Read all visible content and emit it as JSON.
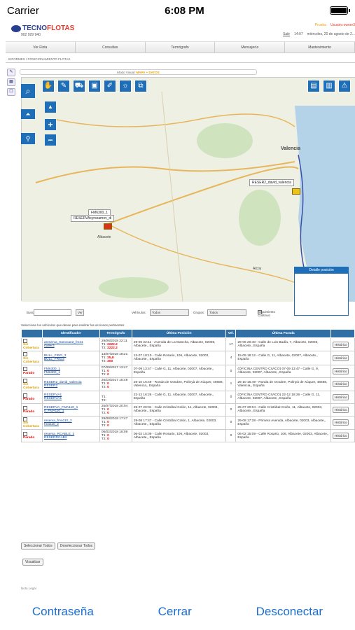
{
  "statusbar": {
    "carrier": "Carrier",
    "time": "6:08 PM"
  },
  "header": {
    "logo_a": "TECNO",
    "logo_b": "FLOTAS",
    "phone": "902 929 940",
    "prueba": "Prueba",
    "usuario": "Usuario:owner3",
    "salir": "Salir",
    "clock": "14:07",
    "date": "miércoles, 20 de agosto de 2..."
  },
  "nav": [
    "Ver Flota",
    "Consultas",
    "Termógrafo",
    "Mensajería",
    "Mantenimiento"
  ],
  "breadcrumb": "INFORMES / POSICIONAMIENTO FLOTAS",
  "modo": {
    "label": "Modo Visual:",
    "value": "MAPA + DATOS"
  },
  "map": {
    "cities": [
      "Valencia",
      "Albacete",
      "Alcoy"
    ],
    "popups": [
      "RESER2_david_valencia",
      "FM6300_1",
      "RESERVAcyrseamov_di"
    ],
    "detail_title": "Detalle posición"
  },
  "controls": {
    "buscar": "Buscar",
    "ver": "Ver",
    "vehiculos": "Vehículos:",
    "vehiculos_val": "Todos",
    "grupos": "Grupos:",
    "grupos_val": "Todos",
    "seguimiento": "Seguimiento Continuo"
  },
  "note": "Seleccione los vehículos que desee para realizar las acciones pertinentes",
  "table": {
    "headers": [
      "Identificador",
      "Termógrafo",
      "Última Posición",
      "Vel.",
      "Última Parada",
      ""
    ],
    "rows": [
      {
        "status": "Sin Cobertura",
        "st": "yel",
        "id1": "areserva_tranvcan2_fm41",
        "id2": "rtaller3",
        "termo": "29/06/2018 22:11",
        "t1": "2222.2",
        "t2": "2222.2",
        "pos": "29-06 22:11 - Avenida de La Mancha, Albacete, 02006, Albacete,, España",
        "vel": "17",
        "parada": "29-06 20:40 - Calle de Luis Badía, 7, Albacete, 02003, Albacete,, España",
        "btn": "Histórico"
      },
      {
        "status": "Sin Cobertura",
        "st": "yel",
        "id1": "BULL_FRIO_3",
        "id2": "BULL_FRIO3",
        "termo": "13/07/2018 18:21",
        "t1": "25,8",
        "t2": "300",
        "pos": "13-07 18:10 - Calle Rosario, 106, Albacete, 02003, Albacete,, España",
        "vel": "4",
        "parada": "15-09 18:12 - Calle G, 11, Albacete, 02007, Albacete,, España",
        "btn": "Histórico"
      },
      {
        "status": "Parado",
        "st": "red",
        "id1": "FM6300_1",
        "id2": "FM6300_1",
        "termo": "07/09/2017 13:47",
        "t1": "0",
        "t2": "0",
        "pos": "07-09 13:47 - Calle G, 11, Albacete, 02007, Albacete,, España",
        "vel": "0",
        "parada": "(OFICINA CENTRO CIVICO) 07-09 13:47 - Calle G, 9, Albacete, 02007, Albacete,, España",
        "btn": "Histórico"
      },
      {
        "status": "Sin Cobertura",
        "st": "yel",
        "id1": "RESER2_david_valencia",
        "id2": "RESER2",
        "termo": "26/10/2017 16:49",
        "t1": "0",
        "t2": "0",
        "pos": "26-10 16:49 - Ronda de Octubre, Polinyà de Xúquer, 46688, Valencia,, España",
        "vel": "1",
        "parada": "26-10 16:49 - Ronda de Octubre, Polinyà de Xúquer, 46688, Valencia,, España",
        "btn": "Histórico"
      },
      {
        "status": "Parado",
        "st": "red",
        "id1": "RESERVA1",
        "id2": "RESERVA1",
        "termo": "",
        "t1": "",
        "t2": "",
        "pos": "22-12 16:26 - Calle G, 11, Albacete, 02007, Albacete,, España",
        "vel": "0",
        "parada": "(OFICINA CENTRO CIVICO) 22-12 16:26 - Calle G, 11, Albacete, 02007, Albacete,, España",
        "btn": "Histórico"
      },
      {
        "status": "Parado",
        "st": "red",
        "id1": "RESERVA_FMA110_1",
        "id2": "0_FMA110_1",
        "termo": "25/07/2018 20:04",
        "t1": "0",
        "t2": "0",
        "pos": "25-07 20:04 - Calle Cristóbal Colón, 11, Albacete, 02003, Albacete,, España",
        "vel": "0",
        "parada": "25-07 20:04 - Calle Cristóbal Colón, 11, Albacete, 02003, Albacete,, España",
        "btn": "Histórico"
      },
      {
        "status": "Sin Cobertura",
        "st": "yel",
        "id1": "reserva_fma110_2",
        "id2": "fma110_2",
        "termo": "29/08/2018 17:47",
        "t1": "0",
        "t2": "0",
        "pos": "29-08 17:47 - Calle Cristóbal Colón, 1, Albacete, 02003, Albacete,, España",
        "vel": "0",
        "parada": "29-08 17:28 - Primera Avenida, Albacete, 02003, Albacete,, España",
        "btn": "Histórico"
      },
      {
        "status": "Parado",
        "st": "red",
        "id1": "reserva_RCABLE_2",
        "id2": "RESERRCAB2",
        "termo": "06/02/2018 16:09",
        "t1": "0",
        "t2": "0",
        "pos": "06-02 15:09 - Calle Rosario, 106, Albacete, 02003, Albacete,, España",
        "vel": "0",
        "parada": "06-02 15:09 - Calle Rosario, 106, Albacete, 02003, Albacete,, España",
        "btn": "Histórico"
      }
    ]
  },
  "buttons": {
    "sel_all": "Seleccionar Todos",
    "desel_all": "Deseleccionar Todos",
    "visualizar": "Visualizar"
  },
  "footer": "Nota Legal",
  "bottombar": {
    "password": "Contraseña",
    "close": "Cerrar",
    "disconnect": "Desconectar"
  }
}
